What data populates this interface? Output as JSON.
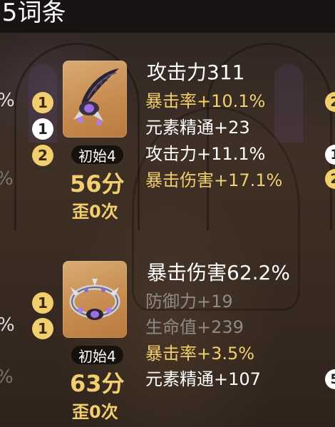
{
  "header": {
    "title": ".5词条"
  },
  "edges": {
    "left": [
      "%",
      "%",
      "%",
      "%"
    ],
    "right_circles": [
      "2",
      "1",
      "2",
      "5"
    ]
  },
  "items": [
    {
      "icon": "plume-artifact-icon",
      "tag": "初始4",
      "score": "56分",
      "crit_note": "歪0次",
      "main_stat": "攻击力311",
      "substats": [
        {
          "text": "暴击率+10.1%",
          "rolls": "1",
          "style": "gold"
        },
        {
          "text": "元素精通+23",
          "rolls": "1",
          "style": "white"
        },
        {
          "text": "攻击力+11.1%",
          "rolls": "2",
          "style": "white"
        },
        {
          "text": "暴击伤害+17.1%",
          "rolls": "",
          "style": "gold"
        }
      ]
    },
    {
      "icon": "circlet-artifact-icon",
      "tag": "初始4",
      "score": "63分",
      "crit_note": "歪0次",
      "main_stat": "暴击伤害62.2%",
      "substats": [
        {
          "text": "防御力+19",
          "rolls": "1",
          "style": "grey"
        },
        {
          "text": "生命值+239",
          "rolls": "1",
          "style": "grey"
        },
        {
          "text": "暴击率+3.5%",
          "rolls": "",
          "style": "gold"
        },
        {
          "text": "元素精通+107",
          "rolls": "",
          "style": "white"
        }
      ]
    }
  ],
  "colors": {
    "gold": "#f2cf6e",
    "grey": "#8e8a86",
    "icon_bg": "#c78c50"
  }
}
